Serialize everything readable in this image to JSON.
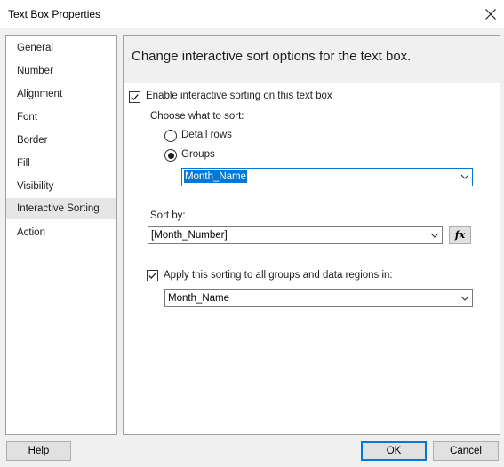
{
  "window": {
    "title": "Text Box Properties"
  },
  "nav": {
    "items": [
      "General",
      "Number",
      "Alignment",
      "Font",
      "Border",
      "Fill",
      "Visibility",
      "Interactive Sorting",
      "Action"
    ],
    "selected_index": 7
  },
  "panel": {
    "header": "Change interactive sort options for the text box.",
    "enable_sorting": {
      "label": "Enable interactive sorting on this text box",
      "checked": true
    },
    "choose_label": "Choose what to sort:",
    "detail_rows": {
      "label": "Detail rows",
      "selected": false
    },
    "groups": {
      "label": "Groups",
      "selected": true
    },
    "group_combo": {
      "value": "Month_Name"
    },
    "sort_by_label": "Sort by:",
    "sort_by_combo": {
      "value": "[Month_Number]"
    },
    "fx_label": "fx",
    "apply_sorting": {
      "label": "Apply this sorting to all groups and data regions in:",
      "checked": true
    },
    "scope_combo": {
      "value": "Month_Name"
    }
  },
  "buttons": {
    "help": "Help",
    "ok": "OK",
    "cancel": "Cancel"
  },
  "colors": {
    "accent": "#0078d7",
    "dialog_bg": "#f0f0f0",
    "nav_selected": "#e6e6e6"
  },
  "icons": {
    "close": "close-icon",
    "dropdown": "chevron-down-icon",
    "check": "checkmark-icon"
  }
}
